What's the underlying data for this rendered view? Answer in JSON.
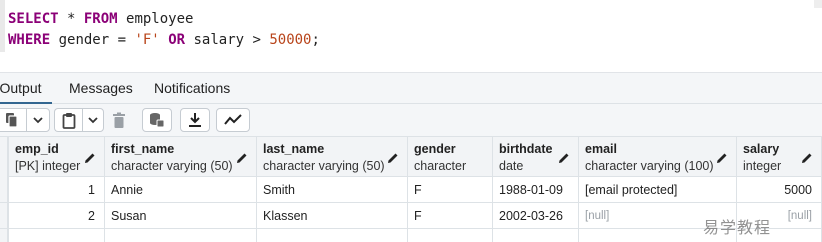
{
  "editor": {
    "line1": {
      "kw1": "SELECT",
      "op1": " * ",
      "kw2": "FROM",
      "rest": " employee"
    },
    "line2": {
      "kw1": "WHERE",
      "mid1": " gender = ",
      "str": "'F'",
      "sp": " ",
      "kw2": "OR",
      "mid2": " salary > ",
      "num": "50000",
      "end": ";"
    }
  },
  "tabs": {
    "output": "Data Output",
    "messages": "Messages",
    "notifications": "Notifications"
  },
  "toolbar": {
    "icons": [
      "copy-icon",
      "chevron-down-icon",
      "paste-icon",
      "chevron-down-icon",
      "trash-icon",
      "save-data-icon",
      "download-icon",
      "graph-icon"
    ]
  },
  "grid": {
    "columns": [
      {
        "name": "emp_id",
        "type": "[PK] integer"
      },
      {
        "name": "first_name",
        "type": "character varying (50)"
      },
      {
        "name": "last_name",
        "type": "character varying (50)"
      },
      {
        "name": "gender",
        "type": "character"
      },
      {
        "name": "birthdate",
        "type": "date"
      },
      {
        "name": "email",
        "type": "character varying (100)"
      },
      {
        "name": "salary",
        "type": "integer"
      }
    ],
    "rows": [
      [
        "1",
        "Annie",
        "Smith",
        "F",
        "1988-01-09",
        "[email protected]",
        "5000"
      ],
      [
        "2",
        "Susan",
        "Klassen",
        "F",
        "2002-03-26",
        "[null]",
        "[null]"
      ]
    ]
  },
  "watermark": "易学教程",
  "colors": {
    "keyword": "#8b0077",
    "literal": "#b8441a",
    "tab_underline": "#326690",
    "null_text": "#9aa0a6"
  }
}
